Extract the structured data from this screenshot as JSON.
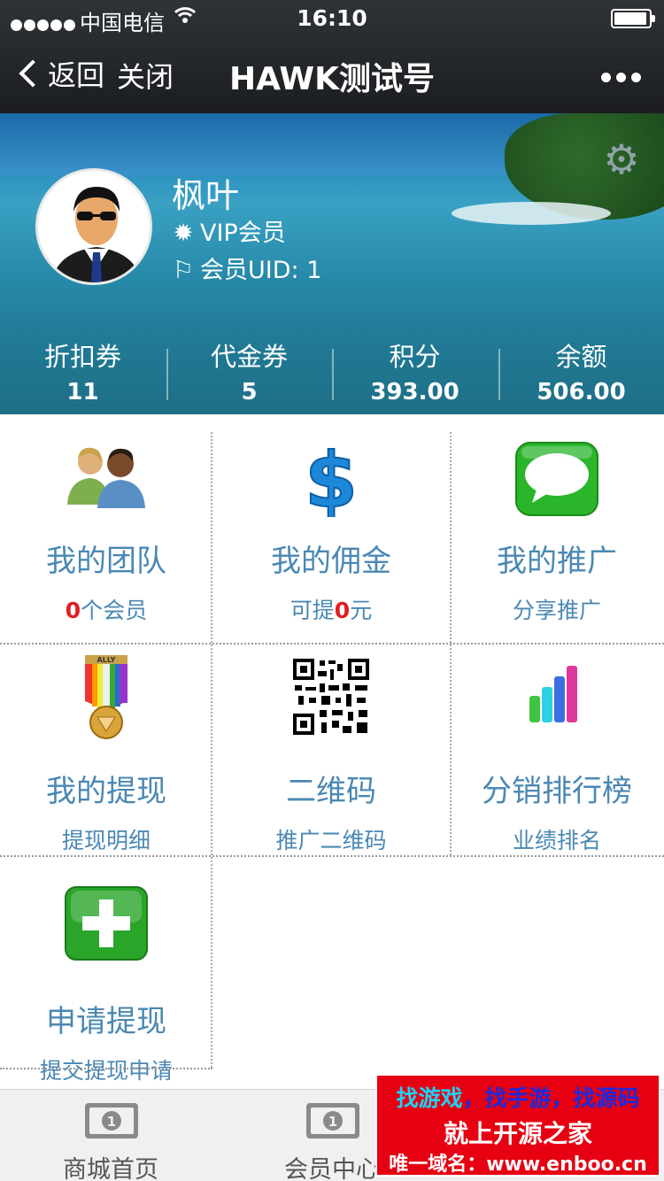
{
  "status_bar": {
    "carrier": "中国电信",
    "time": "16:10"
  },
  "nav": {
    "back_label": "返回",
    "close_label": "关闭",
    "title": "HAWK测试号",
    "more_icon": "more-dots-icon"
  },
  "profile": {
    "name": "枫叶",
    "level": "VIP会员",
    "uid": "会员UID: 1",
    "settings_icon": "gear-icon"
  },
  "stats": [
    {
      "label": "折扣券",
      "value": "11"
    },
    {
      "label": "代金券",
      "value": "5"
    },
    {
      "label": "积分",
      "value": "393.00"
    },
    {
      "label": "余额",
      "value": "506.00"
    }
  ],
  "menu": [
    {
      "title": "我的团队",
      "sub_count": "0",
      "sub_suffix": "个会员",
      "icon": "team-icon"
    },
    {
      "title": "我的佣金",
      "sub_prefix": "可提",
      "sub_count": "0",
      "sub_suffix": "元",
      "icon": "dollar-icon"
    },
    {
      "title": "我的推广",
      "sub": "分享推广",
      "icon": "chat-bubble-icon"
    },
    {
      "title": "我的提现",
      "sub": "提现明细",
      "icon": "medal-icon",
      "medal_text": "ALLY"
    },
    {
      "title": "二维码",
      "sub": "推广二维码",
      "icon": "qrcode-icon"
    },
    {
      "title": "分销排行榜",
      "sub": "业绩排名",
      "icon": "bar-chart-icon"
    },
    {
      "title": "申请提现",
      "sub": "提交提现申请",
      "icon": "plus-icon"
    }
  ],
  "tabbar": [
    {
      "label": "商城首页",
      "icon": "banknote-icon"
    },
    {
      "label": "会员中心",
      "icon": "banknote-icon"
    }
  ],
  "ad": {
    "line1_a": "找游戏",
    "line1_b": "，找手游，找源码",
    "line2": "就上开源之家",
    "line3": "唯一域名：www.enboo.cn"
  },
  "colors": {
    "accent_text": "#4a88b3",
    "highlight": "#e01f1f",
    "ad_background": "#e60012"
  }
}
